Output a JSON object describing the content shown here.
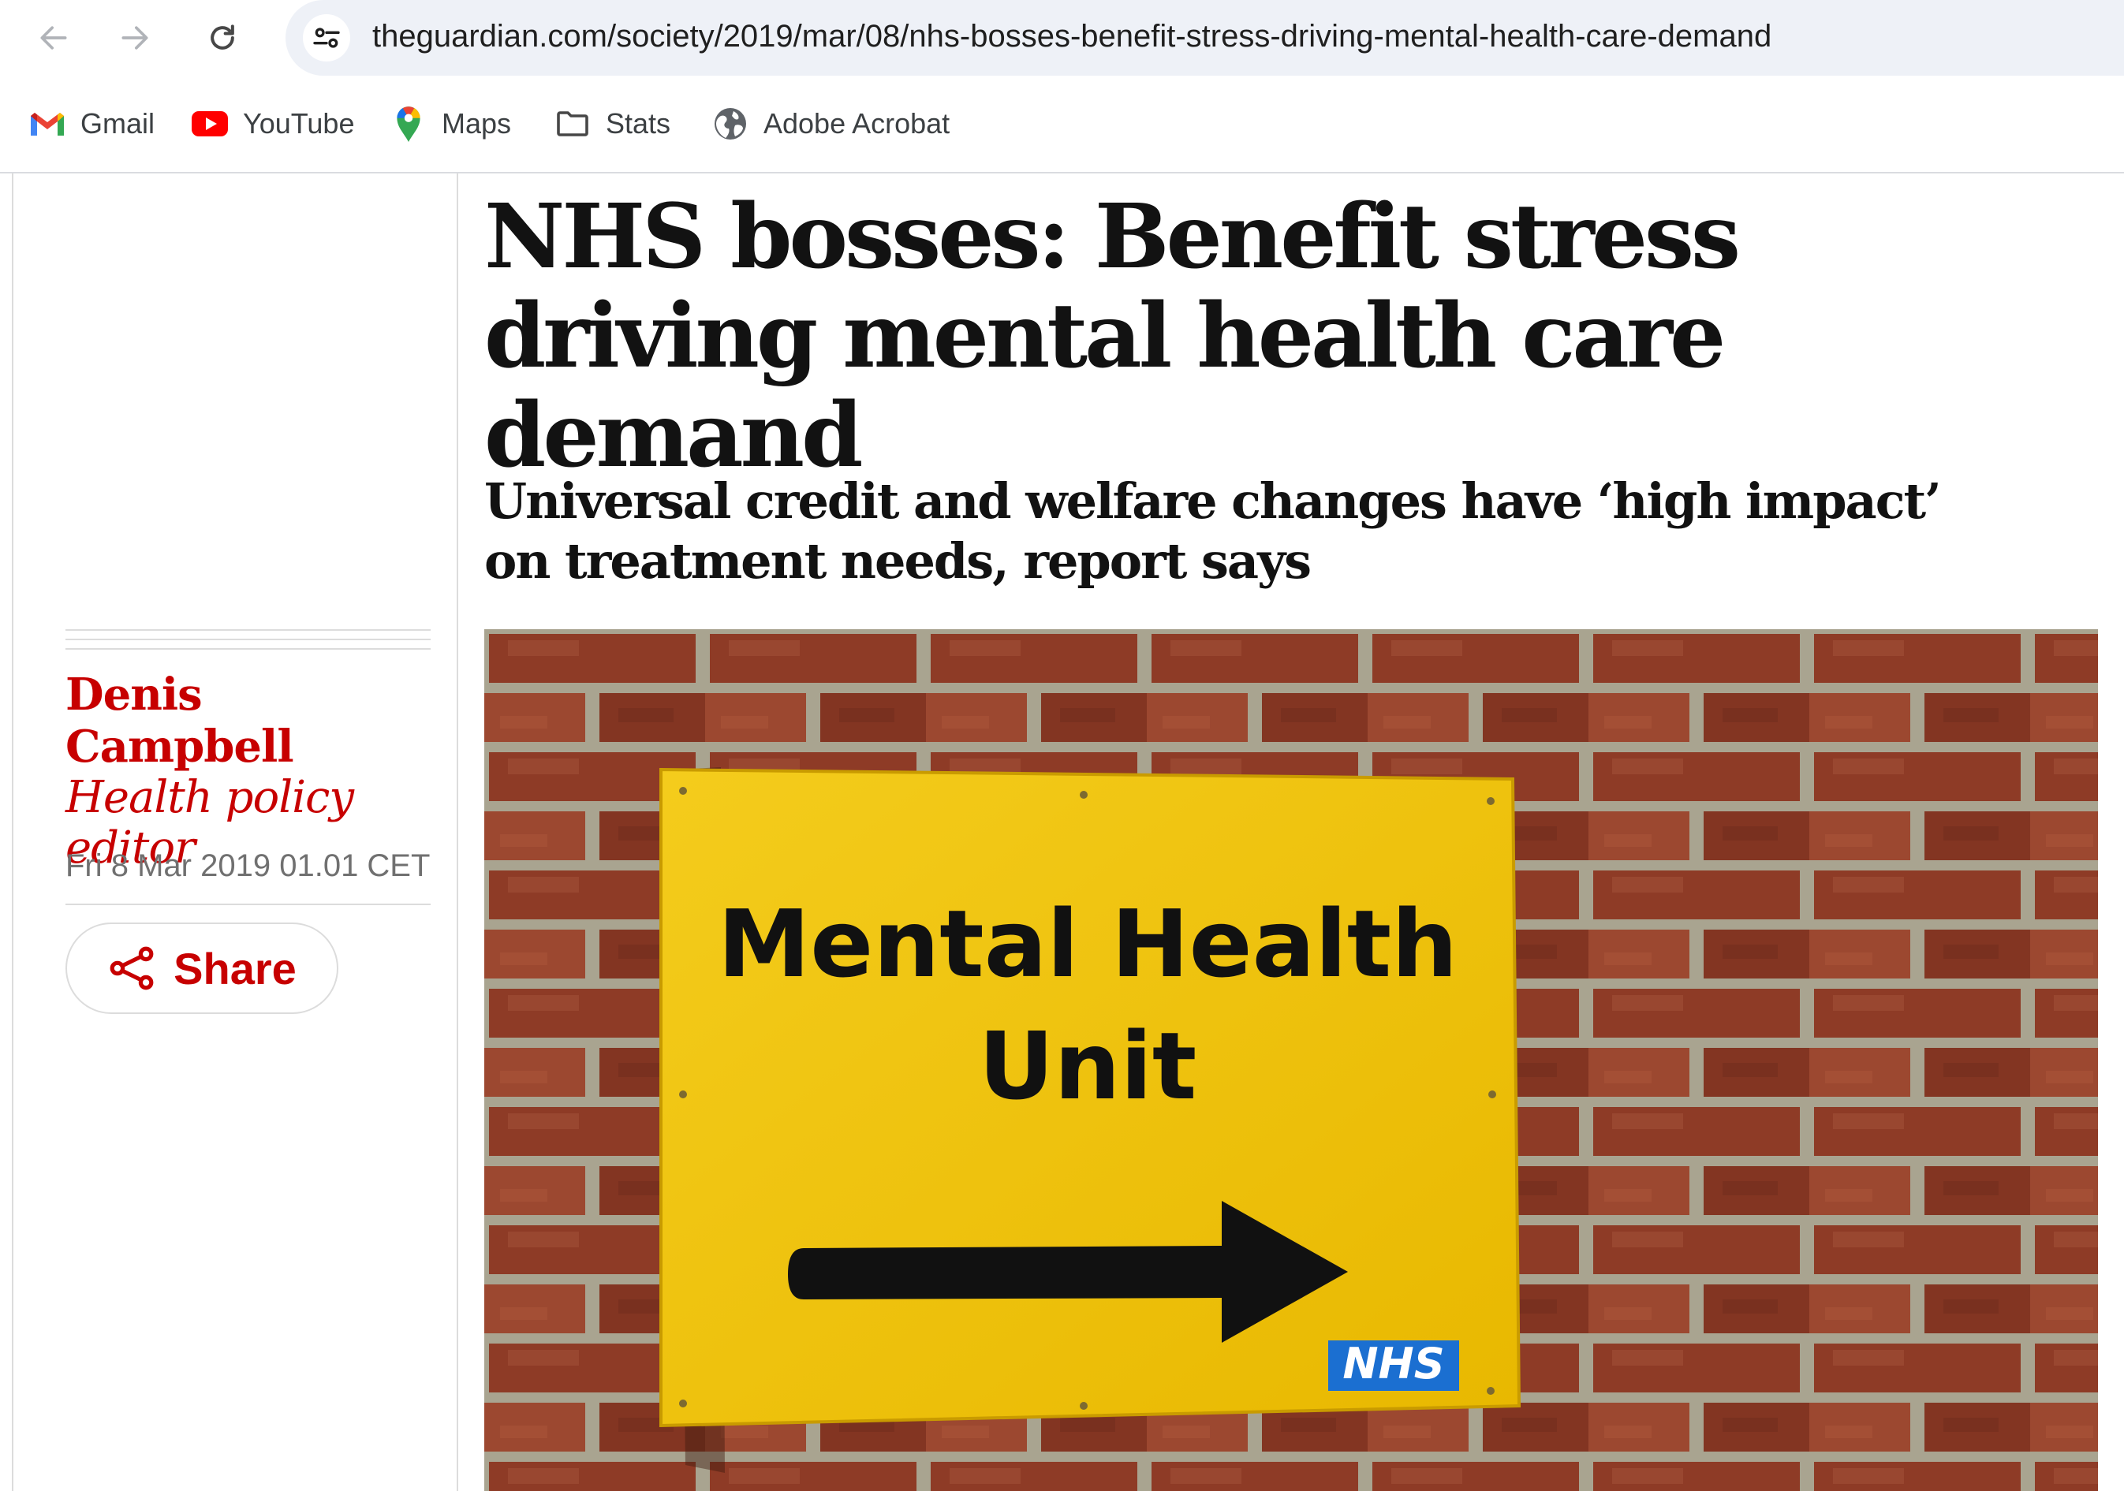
{
  "browser": {
    "url": "theguardian.com/society/2019/mar/08/nhs-bosses-benefit-stress-driving-mental-health-care-demand",
    "bookmarks": [
      {
        "label": "Gmail",
        "icon": "gmail-icon"
      },
      {
        "label": "YouTube",
        "icon": "youtube-icon"
      },
      {
        "label": "Maps",
        "icon": "maps-icon"
      },
      {
        "label": "Stats",
        "icon": "folder-icon"
      },
      {
        "label": "Adobe Acrobat",
        "icon": "globe-icon"
      }
    ]
  },
  "article": {
    "headline": "NHS bosses: Benefit stress driving mental health care demand",
    "standfirst": "Universal credit and welfare changes have ‘high impact’ on treatment needs, report says",
    "author": {
      "name": "Denis Campbell",
      "role": "Health policy editor"
    },
    "dateline": "Fri 8 Mar 2019 01.01 CET",
    "share_label": "Share",
    "image": {
      "sign_line1": "Mental Health",
      "sign_line2": "Unit",
      "logo_text": "NHS"
    }
  },
  "colors": {
    "accent_red": "#c70000",
    "sign_yellow": "#f2c500",
    "nhs_blue": "#1b6fd1",
    "brick": "#8e3b26"
  }
}
